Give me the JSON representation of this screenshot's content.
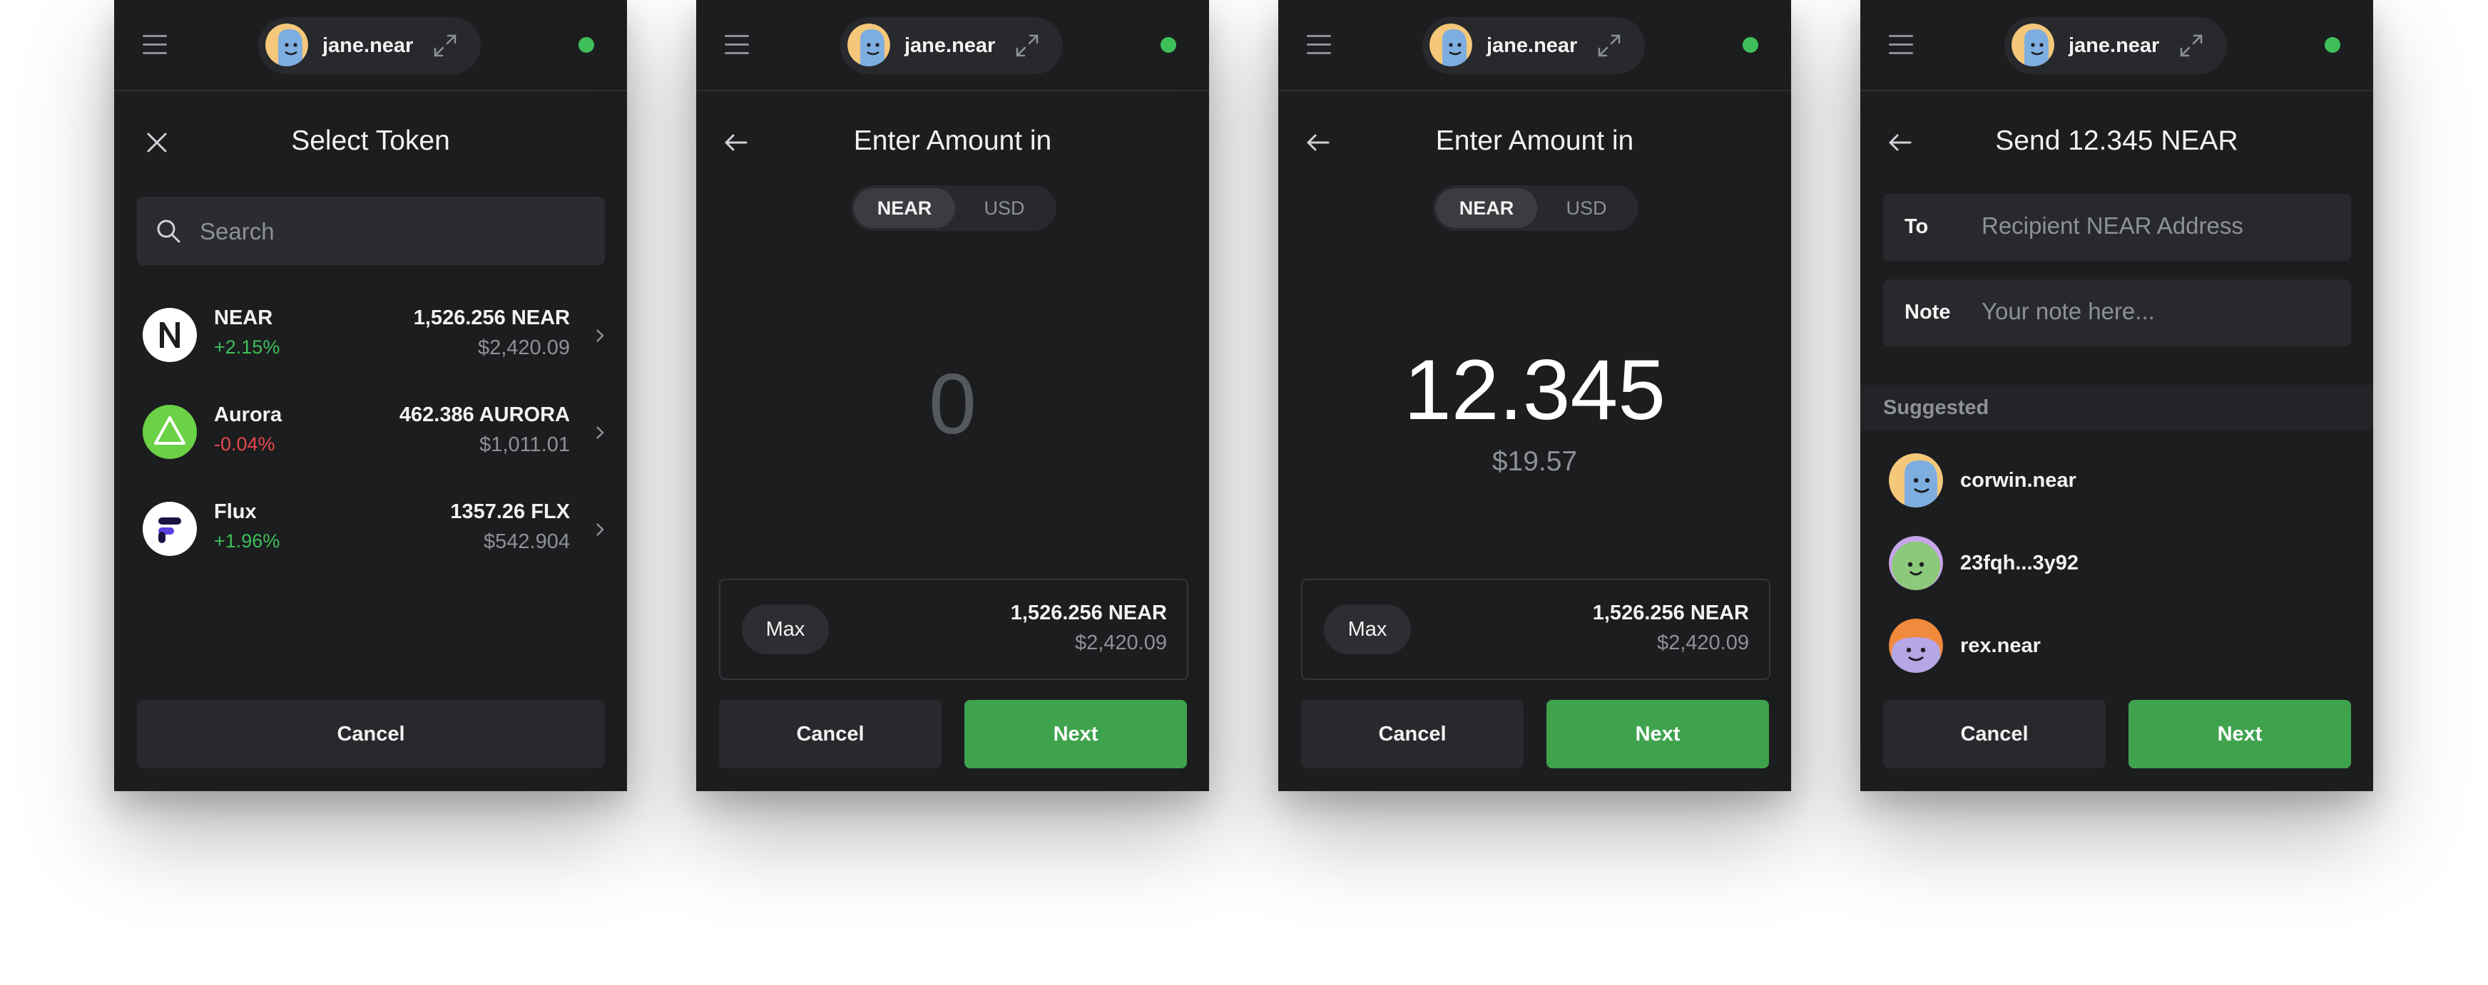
{
  "common": {
    "account_name": "jane.near",
    "status_color": "#3fbf5a",
    "accent": "#3fa34d"
  },
  "screen1": {
    "title": "Select Token",
    "search_placeholder": "Search",
    "tokens": [
      {
        "name": "NEAR",
        "change": "+2.15%",
        "amount": "1,526.256 NEAR",
        "usd": "$2,420.09",
        "icon": "near-logo-icon"
      },
      {
        "name": "Aurora",
        "change": "-0.04%",
        "amount": "462.386 AURORA",
        "usd": "$1,011.01",
        "icon": "aurora-logo-icon"
      },
      {
        "name": "Flux",
        "change": "+1.96%",
        "amount": "1357.26 FLX",
        "usd": "$542.904",
        "icon": "flux-logo-icon"
      }
    ],
    "cancel_label": "Cancel"
  },
  "screen2": {
    "title": "Enter Amount in",
    "toggle": [
      "NEAR",
      "USD"
    ],
    "amount": "0",
    "max_label": "Max",
    "balance_amount": "1,526.256 NEAR",
    "balance_usd": "$2,420.09",
    "cancel_label": "Cancel",
    "next_label": "Next"
  },
  "screen3": {
    "title": "Enter Amount in",
    "toggle": [
      "NEAR",
      "USD"
    ],
    "amount": "12.345",
    "amount_usd": "$19.57",
    "max_label": "Max",
    "balance_amount": "1,526.256 NEAR",
    "balance_usd": "$2,420.09",
    "cancel_label": "Cancel",
    "next_label": "Next"
  },
  "screen4": {
    "title": "Send 12.345 NEAR",
    "to_label": "To",
    "to_placeholder": "Recipient NEAR Address",
    "note_label": "Note",
    "note_placeholder": "Your note here...",
    "suggested_label": "Suggested",
    "contacts": [
      {
        "name": "corwin.near",
        "avatar": "blue-face-avatar"
      },
      {
        "name": "23fqh...3y92",
        "avatar": "green-face-avatar"
      },
      {
        "name": "rex.near",
        "avatar": "purple-face-avatar"
      }
    ],
    "cancel_label": "Cancel",
    "next_label": "Next"
  }
}
